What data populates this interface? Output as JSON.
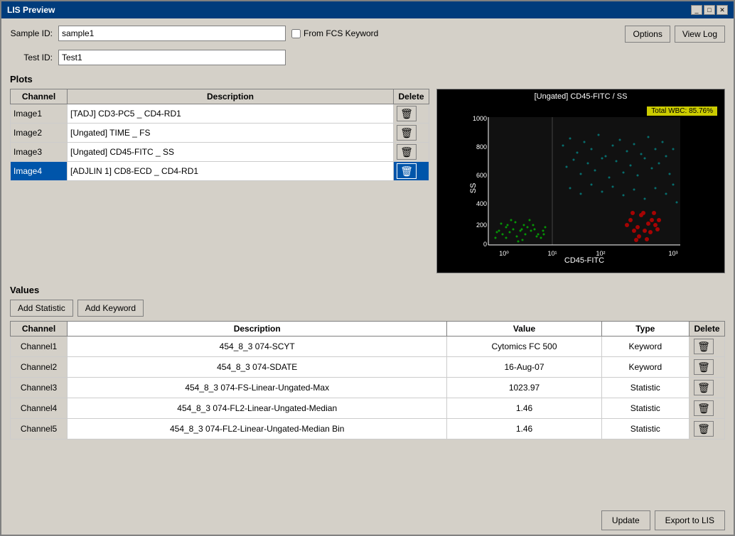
{
  "window": {
    "title": "LIS Preview"
  },
  "header": {
    "sample_id_label": "Sample ID:",
    "sample_id_value": "sample1",
    "from_fcs_label": "From FCS Keyword",
    "test_id_label": "Test ID:",
    "test_id_value": "Test1",
    "options_btn": "Options",
    "view_log_btn": "View Log"
  },
  "plots": {
    "section_title": "Plots",
    "columns": [
      "Channel",
      "Description",
      "Delete"
    ],
    "rows": [
      {
        "channel": "Image1",
        "description": "[TADJ] CD3-PC5 _ CD4-RD1",
        "selected": false
      },
      {
        "channel": "Image2",
        "description": "[Ungated] TIME _ FS",
        "selected": false
      },
      {
        "channel": "Image3",
        "description": "[Ungated] CD45-FITC _ SS",
        "selected": false
      },
      {
        "channel": "Image4",
        "description": "[ADJLIN 1] CD8-ECD _ CD4-RD1",
        "selected": true
      }
    ]
  },
  "chart": {
    "title": "[Ungated] CD45-FITC / SS",
    "badge": "Total WBC: 85.76%",
    "x_label": "CD45-FITC",
    "y_label": "SS"
  },
  "values": {
    "section_title": "Values",
    "add_statistic_btn": "Add Statistic",
    "add_keyword_btn": "Add Keyword",
    "columns": [
      "Channel",
      "Description",
      "Value",
      "Type",
      "Delete"
    ],
    "rows": [
      {
        "channel": "Channel1",
        "description": "454_8_3 074-SCYT",
        "value": "Cytomics FC 500",
        "type": "Keyword"
      },
      {
        "channel": "Channel2",
        "description": "454_8_3 074-SDATE",
        "value": "16-Aug-07",
        "type": "Keyword"
      },
      {
        "channel": "Channel3",
        "description": "454_8_3 074-FS-Linear-Ungated-Max",
        "value": "1023.97",
        "type": "Statistic"
      },
      {
        "channel": "Channel4",
        "description": "454_8_3 074-FL2-Linear-Ungated-Median",
        "value": "1.46",
        "type": "Statistic"
      },
      {
        "channel": "Channel5",
        "description": "454_8_3 074-FL2-Linear-Ungated-Median Bin",
        "value": "1.46",
        "type": "Statistic"
      }
    ]
  },
  "footer": {
    "update_btn": "Update",
    "export_btn": "Export to LIS"
  },
  "icons": {
    "trash": "🗑"
  }
}
